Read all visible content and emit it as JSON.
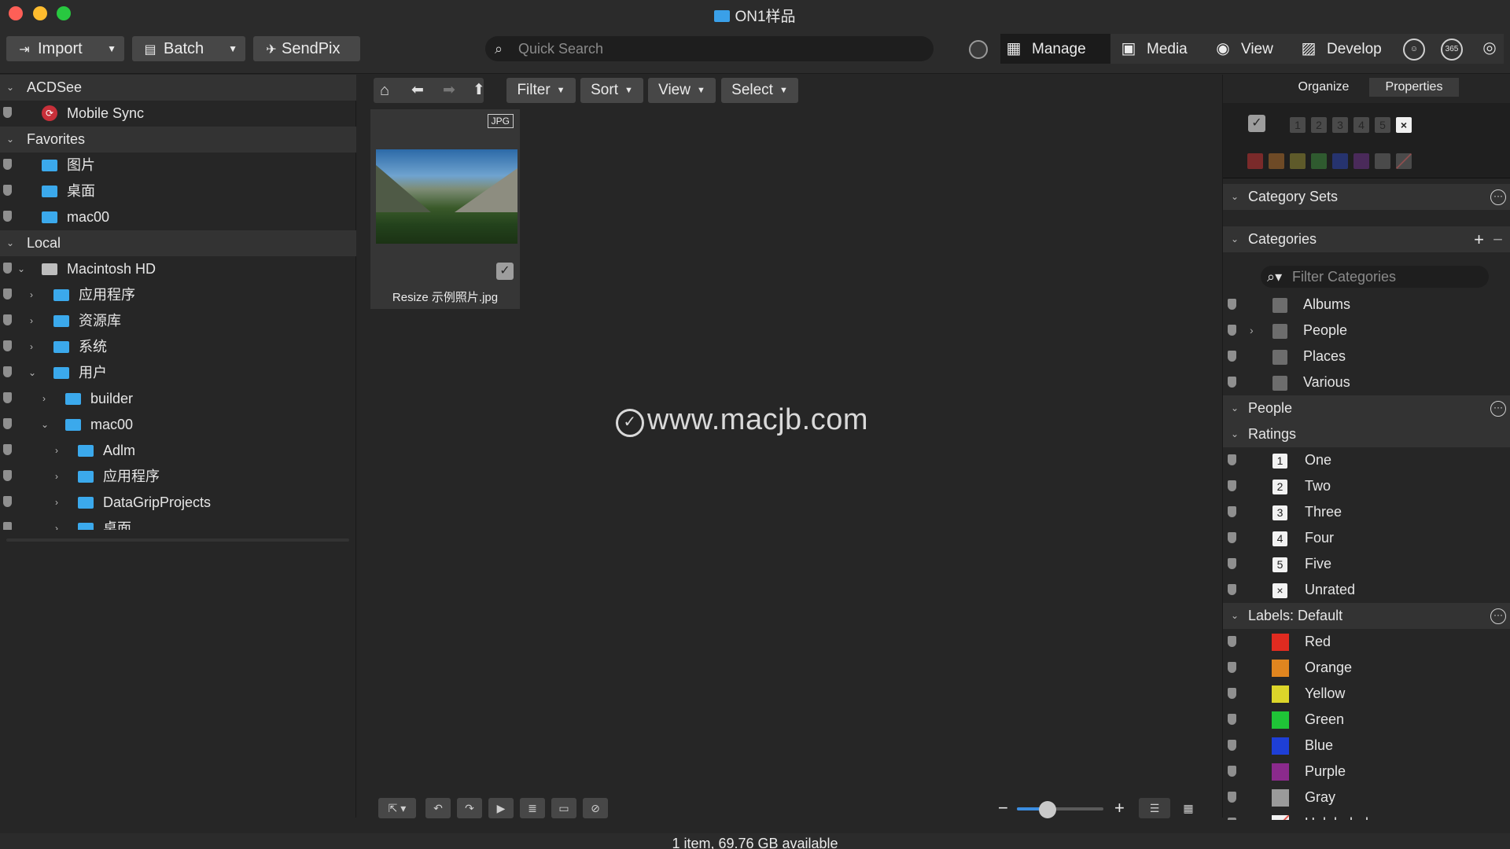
{
  "window": {
    "title": "ON1样品"
  },
  "toolbar": {
    "import_label": "Import",
    "batch_label": "Batch",
    "sendpix_label": "SendPix",
    "search_placeholder": "Quick Search",
    "modes": [
      {
        "label": "Manage",
        "active": true
      },
      {
        "label": "Media",
        "active": false
      },
      {
        "label": "View",
        "active": false
      },
      {
        "label": "Develop",
        "active": false
      }
    ],
    "extra_icon_365": "365"
  },
  "sidebar": {
    "sections": {
      "acdsee": "ACDSee",
      "favorites": "Favorites",
      "local": "Local"
    },
    "items": {
      "mobile_sync": "Mobile Sync",
      "fav_pictures": "图片",
      "fav_desktop": "桌面",
      "fav_mac00": "mac00",
      "macintosh_hd": "Macintosh HD",
      "applications": "应用程序",
      "library": "资源库",
      "system": "系统",
      "users": "用户",
      "builder": "builder",
      "mac00": "mac00",
      "adlm": "Adlm",
      "user_apps": "应用程序",
      "datagrip": "DataGripProjects",
      "user_desktop": "桌面"
    }
  },
  "browser": {
    "nav": {
      "filter": "Filter",
      "sort": "Sort",
      "view": "View",
      "select": "Select"
    },
    "thumbnail": {
      "badge": "JPG",
      "filename": "Resize 示例照片.jpg",
      "checked": true
    },
    "watermark": "www.macjb.com"
  },
  "rightpanel": {
    "tabs": {
      "organize": "Organize",
      "properties": "Properties"
    },
    "rating_filter": [
      "1",
      "2",
      "3",
      "4",
      "5",
      "×"
    ],
    "label_filter_colors": [
      "#7a2a2a",
      "#6e4a26",
      "#5e5a2a",
      "#2f5a2f",
      "#26336e",
      "#4a2a5a",
      "#4a4a4a"
    ],
    "sections": {
      "category_sets": "Category Sets",
      "categories": "Categories",
      "people": "People",
      "ratings": "Ratings",
      "labels": "Labels: Default"
    },
    "filter_categories_placeholder": "Filter Categories",
    "categories": [
      "Albums",
      "People",
      "Places",
      "Various"
    ],
    "ratings": [
      {
        "num": "1",
        "label": "One"
      },
      {
        "num": "2",
        "label": "Two"
      },
      {
        "num": "3",
        "label": "Three"
      },
      {
        "num": "4",
        "label": "Four"
      },
      {
        "num": "5",
        "label": "Five"
      },
      {
        "num": "×",
        "label": "Unrated"
      }
    ],
    "labels": [
      {
        "label": "Red",
        "color": "#e02b20"
      },
      {
        "label": "Orange",
        "color": "#e0851f"
      },
      {
        "label": "Yellow",
        "color": "#dcd52a"
      },
      {
        "label": "Green",
        "color": "#1fc437"
      },
      {
        "label": "Blue",
        "color": "#1e3fd6"
      },
      {
        "label": "Purple",
        "color": "#8b2a8c"
      },
      {
        "label": "Gray",
        "color": "#9a9a9a"
      },
      {
        "label": "Unlabeled",
        "color": "#f2f2f2"
      }
    ]
  },
  "status": {
    "text": "1 item, 69.76 GB available"
  }
}
